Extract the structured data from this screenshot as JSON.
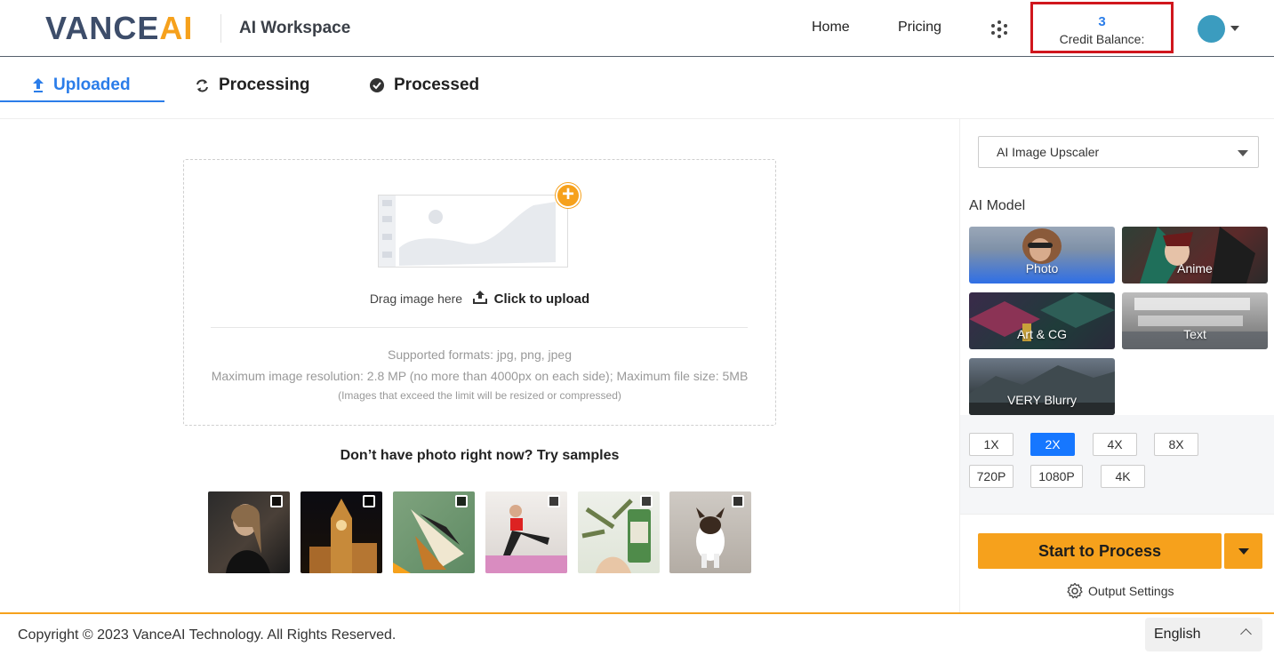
{
  "header": {
    "logo_vance": "VANCE",
    "logo_ai": "AI",
    "workspace": "AI Workspace",
    "nav": {
      "home": "Home",
      "pricing": "Pricing"
    },
    "credit_value": "3",
    "credit_label": "Credit Balance:"
  },
  "tabs": [
    {
      "label": "Uploaded",
      "icon": "upload-arrow-icon",
      "active": true
    },
    {
      "label": "Processing",
      "icon": "refresh-icon",
      "active": false
    },
    {
      "label": "Processed",
      "icon": "check-circle-icon",
      "active": false
    }
  ],
  "upload": {
    "drag_text": "Drag image here",
    "click_text": "Click to upload",
    "formats": "Supported formats: jpg, png, jpeg",
    "max_res": "Maximum image resolution: 2.8 MP (no more than 4000px on each side); Maximum file size: 5MB",
    "resize_note": "(Images that exceed the limit will be resized or compressed)"
  },
  "samples": {
    "title": "Don’t have photo right now? Try samples",
    "items": [
      "portrait",
      "clock-tower",
      "butterfly",
      "yoga",
      "bottle",
      "dog"
    ]
  },
  "panel": {
    "tool_select": "AI Image Upscaler",
    "model_label": "AI Model",
    "models": [
      "Photo",
      "Anime",
      "Art & CG",
      "Text",
      "VERY Blurry"
    ],
    "scales": [
      "1X",
      "2X",
      "4X",
      "8X",
      "720P",
      "1080P",
      "4K"
    ],
    "selected_scale": "2X",
    "start_label": "Start to Process",
    "output_settings": "Output Settings"
  },
  "footer": {
    "copyright": "Copyright © 2023 VanceAI Technology. All Rights Reserved.",
    "language": "English"
  },
  "colors": {
    "accent": "#2b7de9",
    "brand_orange": "#f6a11c",
    "highlight_red": "#d0161d"
  }
}
